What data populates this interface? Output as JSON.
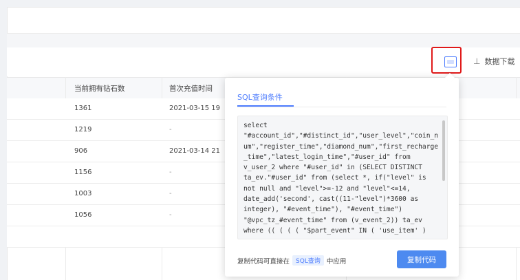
{
  "toolbar": {
    "download_label": "数据下载",
    "download_icon": "download-icon"
  },
  "table": {
    "headers": [
      "当前拥有钻石数",
      "首次充值时间"
    ],
    "rows": [
      {
        "diamond_num": "1361",
        "first_recharge_time": "2021-03-15 19"
      },
      {
        "diamond_num": "1219",
        "first_recharge_time": "-"
      },
      {
        "diamond_num": "906",
        "first_recharge_time": "2021-03-14 21"
      },
      {
        "diamond_num": "1156",
        "first_recharge_time": "-"
      },
      {
        "diamond_num": "1003",
        "first_recharge_time": "-"
      },
      {
        "diamond_num": "1056",
        "first_recharge_time": "-"
      }
    ]
  },
  "popover": {
    "title": "SQL查询条件",
    "sql_code": "select\n\"#account_id\",\"#distinct_id\",\"user_level\",\"coin_n\num\",\"register_time\",\"diamond_num\",\"first_recharge\n_time\",\"latest_login_time\",\"#user_id\" from\nv_user_2 where \"#user_id\" in (SELECT DISTINCT\nta_ev.\"#user_id\" from (select *, if(\"level\" is\nnot null and \"level\">=-12 and \"level\"<=14,\ndate_add('second', cast((11-\"level\")*3600 as\ninteger), \"#event_time\"), \"#event_time\")\n\"@vpc_tz_#event_time\" from (v_event_2)) ta_ev\nwhere (( ( ( ( \"$part_event\" IN ( 'use_item' )",
    "footer_prefix": "复制代码可直接在",
    "footer_tag": "SQL查询",
    "footer_suffix": "中应用",
    "copy_label": "复制代码"
  },
  "colors": {
    "accent": "#4d7cfe",
    "highlight": "#e01919",
    "button": "#4d8af0"
  }
}
